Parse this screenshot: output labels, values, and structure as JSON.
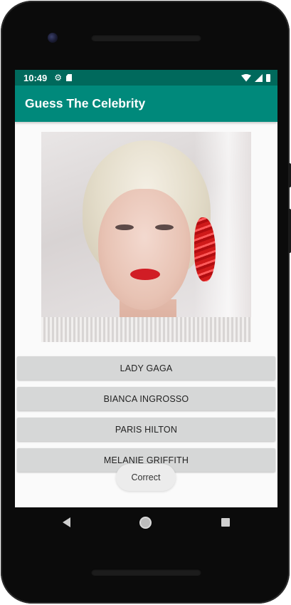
{
  "status_bar": {
    "time": "10:49",
    "icons": [
      "settings-icon",
      "sd-card-icon",
      "wifi-icon",
      "signal-icon",
      "battery-icon"
    ]
  },
  "app_bar": {
    "title": "Guess The Celebrity"
  },
  "photo": {
    "description_icon": "celebrity-photo"
  },
  "answers": [
    {
      "label": "LADY GAGA"
    },
    {
      "label": "BIANCA INGROSSO"
    },
    {
      "label": "PARIS HILTON"
    },
    {
      "label": "MELANIE GRIFFITH"
    }
  ],
  "toast": {
    "message": "Correct"
  },
  "nav_bar": {
    "icons": [
      "back-icon",
      "home-icon",
      "recents-icon"
    ]
  },
  "colors": {
    "primary": "#00897b",
    "primary_dark": "#00695c",
    "button_bg": "#d6d7d7",
    "screen_bg": "#fafafa"
  }
}
